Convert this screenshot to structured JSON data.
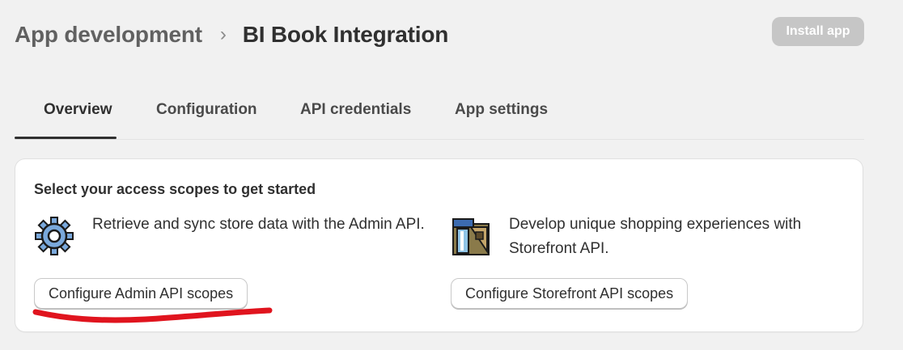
{
  "header": {
    "parent": "App development",
    "separator": "›",
    "current": "BI Book Integration",
    "install_label": "Install app"
  },
  "tabs": [
    {
      "label": "Overview",
      "active": true
    },
    {
      "label": "Configuration",
      "active": false
    },
    {
      "label": "API credentials",
      "active": false
    },
    {
      "label": "App settings",
      "active": false
    }
  ],
  "card": {
    "title": "Select your access scopes to get started",
    "admin": {
      "icon": "gear-icon",
      "description": "Retrieve and sync store data with the Admin API.",
      "button_label": "Configure Admin API scopes"
    },
    "storefront": {
      "icon": "storefront-icon",
      "description": "Develop unique shopping experiences with Storefront API.",
      "button_label": "Configure Storefront API scopes"
    }
  },
  "colors": {
    "background": "#f1f1f1",
    "text": "#303030",
    "disabled_button": "#c6c6c6",
    "annotation": "#e0141e"
  }
}
